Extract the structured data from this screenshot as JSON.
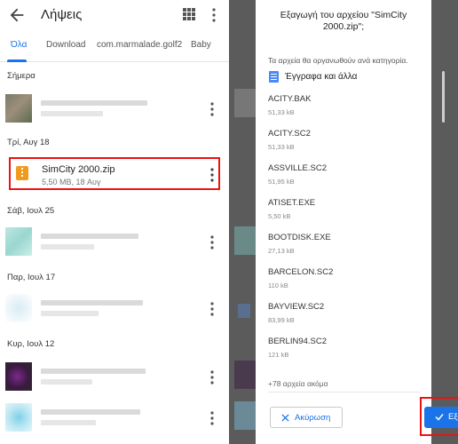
{
  "left": {
    "title": "Λήψεις",
    "tabs": [
      "Όλα",
      "Download",
      "com.marmalade.golf2",
      "Baby"
    ],
    "sections": [
      "Σήμερα",
      "Τρί, Αυγ 18",
      "Σάβ, Ιουλ 25",
      "Παρ, Ιουλ 17",
      "Κυρ, Ιουλ 12"
    ],
    "highlighted_file": {
      "name": "SimCity 2000.zip",
      "meta": "5,50 MB, 18 Αυγ"
    }
  },
  "dialog": {
    "title": "Εξαγωγή του αρχείου \"SimCity 2000.zip\";",
    "subtitle": "Τα αρχεία θα οργανωθούν ανά κατηγορία.",
    "category": "Έγγραφα και άλλα",
    "files": [
      {
        "name": "ACITY.BAK",
        "size": "51,33 kB"
      },
      {
        "name": "ACITY.SC2",
        "size": "51,33 kB"
      },
      {
        "name": "ASSVILLE.SC2",
        "size": "51,95 kB"
      },
      {
        "name": "ATISET.EXE",
        "size": "5,50 kB"
      },
      {
        "name": "BOOTDISK.EXE",
        "size": "27,13 kB"
      },
      {
        "name": "BARCELON.SC2",
        "size": "110 kB"
      },
      {
        "name": "BAYVIEW.SC2",
        "size": "83,99 kB"
      },
      {
        "name": "BERLIN94.SC2",
        "size": "121 kB"
      }
    ],
    "more": "+78 αρχεία ακόμα",
    "cancel_label": "Ακύρωση",
    "extract_label": "Εξαγωγή"
  },
  "colors": {
    "accent": "#1a73e8",
    "highlight": "#ee1111",
    "zip": "#f29a1e"
  },
  "icons": [
    "back-arrow-icon",
    "grid-view-icon",
    "more-vert-icon",
    "zip-file-icon",
    "document-icon",
    "close-icon",
    "check-icon"
  ]
}
